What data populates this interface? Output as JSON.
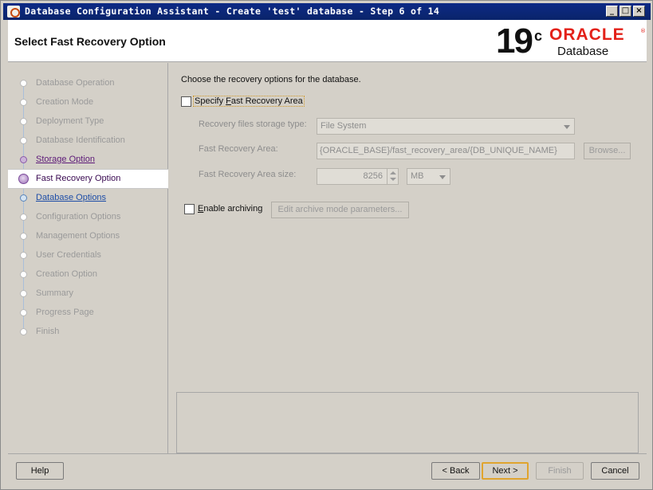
{
  "window": {
    "title": "Database Configuration Assistant - Create 'test' database - Step 6 of 14",
    "controls": {
      "minimize": "_",
      "maximize": "□",
      "close": "×"
    }
  },
  "header": {
    "page_title": "Select Fast Recovery Option",
    "logo": {
      "version": "19",
      "version_suffix": "c",
      "brand": "ORACLE",
      "reg": "®",
      "product": "Database",
      "brand_color": "#E32119"
    }
  },
  "nav": {
    "items": [
      {
        "label": "Database Operation",
        "state": "pending"
      },
      {
        "label": "Creation Mode",
        "state": "pending"
      },
      {
        "label": "Deployment Type",
        "state": "pending"
      },
      {
        "label": "Database Identification",
        "state": "pending"
      },
      {
        "label": "Storage Option",
        "state": "visited"
      },
      {
        "label": "Fast Recovery Option",
        "state": "current"
      },
      {
        "label": "Database Options",
        "state": "next"
      },
      {
        "label": "Configuration Options",
        "state": "pending"
      },
      {
        "label": "Management Options",
        "state": "pending"
      },
      {
        "label": "User Credentials",
        "state": "pending"
      },
      {
        "label": "Creation Option",
        "state": "pending"
      },
      {
        "label": "Summary",
        "state": "pending"
      },
      {
        "label": "Progress Page",
        "state": "pending"
      },
      {
        "label": "Finish",
        "state": "pending"
      }
    ]
  },
  "content": {
    "instruction": "Choose the recovery options for the database.",
    "specify_fra": {
      "label_prefix": "Specify ",
      "label_key": "F",
      "label_suffix": "ast Recovery Area",
      "checked": false
    },
    "storage_type": {
      "label": "Recovery files storage type:",
      "value": "File System"
    },
    "fra_location": {
      "label": "Fast Recovery Area:",
      "value": "{ORACLE_BASE}/fast_recovery_area/{DB_UNIQUE_NAME}",
      "browse_label": "Browse..."
    },
    "fra_size": {
      "label": "Fast Recovery Area size:",
      "value": "8256",
      "unit": "MB"
    },
    "archiving": {
      "label_key": "E",
      "label_suffix": "nable archiving",
      "checked": false,
      "params_button": "Edit archive mode parameters..."
    }
  },
  "footer": {
    "help": "Help",
    "back": "< Back",
    "next": "Next >",
    "finish": "Finish",
    "cancel": "Cancel"
  }
}
